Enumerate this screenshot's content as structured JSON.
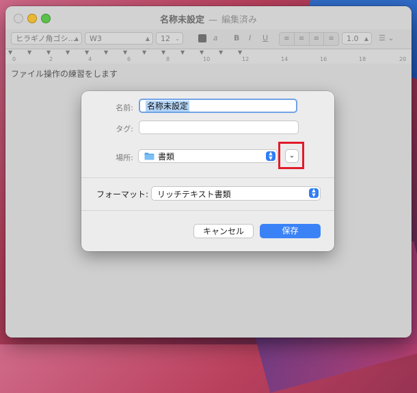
{
  "window": {
    "title": "名称未設定",
    "separator": "—",
    "state": "編集済み"
  },
  "toolbar": {
    "font_family": "ヒラギノ角ゴシ…",
    "font_style": "W3",
    "font_size": "12",
    "bold": "B",
    "italic": "I",
    "underline": "U",
    "line_spacing": "1.0"
  },
  "ruler": {
    "numbers": [
      "0",
      "2",
      "4",
      "6",
      "8",
      "10",
      "12",
      "14",
      "16",
      "18",
      "20"
    ]
  },
  "document": {
    "text": "ファイル操作の練習をします"
  },
  "save_dialog": {
    "name_label": "名前:",
    "name_value": "名称未設定",
    "tags_label": "タグ:",
    "location_label": "場所:",
    "location_value": "書類",
    "format_label": "フォーマット:",
    "format_value": "リッチテキスト書類",
    "cancel_label": "キャンセル",
    "save_label": "保存"
  },
  "colors": {
    "accent": "#3b82f6",
    "highlight_box": "#e01a2a",
    "selection": "#b3d4f6"
  }
}
